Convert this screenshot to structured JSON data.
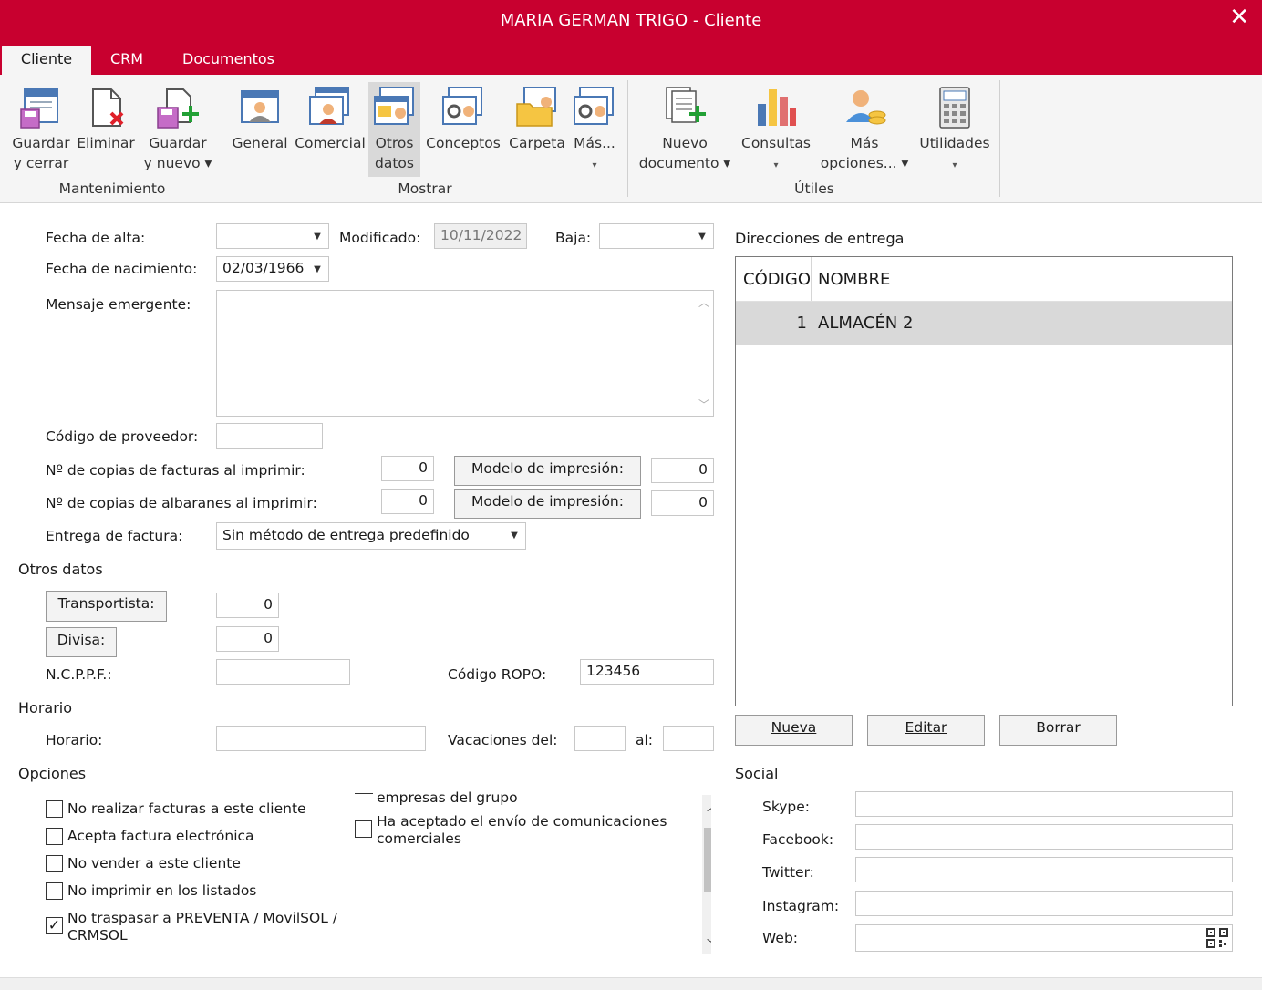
{
  "window": {
    "title": "MARIA GERMAN TRIGO - Cliente",
    "close_glyph": "✕"
  },
  "tabs": [
    {
      "label": "Cliente",
      "active": true
    },
    {
      "label": "CRM",
      "active": false
    },
    {
      "label": "Documentos",
      "active": false
    }
  ],
  "ribbon": {
    "buttons": [
      {
        "line1": "Guardar",
        "line2": "y cerrar",
        "icon": "save-close-icon"
      },
      {
        "line1": "Eliminar",
        "line2": "",
        "icon": "delete-icon"
      },
      {
        "line1": "Guardar",
        "line2": "y nuevo ▾",
        "icon": "save-new-icon"
      },
      {
        "line1": "General",
        "line2": "",
        "icon": "general-icon"
      },
      {
        "line1": "Comercial",
        "line2": "",
        "icon": "commercial-icon"
      },
      {
        "line1": "Otros",
        "line2": "datos",
        "icon": "other-data-icon"
      },
      {
        "line1": "Conceptos",
        "line2": "",
        "icon": "concepts-icon"
      },
      {
        "line1": "Carpeta",
        "line2": "",
        "icon": "folder-icon"
      },
      {
        "line1": "Más...",
        "line2": "▾",
        "icon": "more-icon"
      },
      {
        "line1": "Nuevo",
        "line2": "documento ▾",
        "icon": "new-document-icon"
      },
      {
        "line1": "Consultas",
        "line2": "▾",
        "icon": "queries-icon"
      },
      {
        "line1": "Más",
        "line2": "opciones... ▾",
        "icon": "more-options-icon"
      },
      {
        "line1": "Utilidades",
        "line2": "▾",
        "icon": "utilities-icon"
      }
    ],
    "groups": [
      "Mantenimiento",
      "Mostrar",
      "Útiles"
    ]
  },
  "form": {
    "fecha_alta_label": "Fecha de alta:",
    "fecha_alta_value": "",
    "modificado_label": "Modificado:",
    "modificado_value": "10/11/2022",
    "baja_label": "Baja:",
    "baja_value": "",
    "fecha_nacimiento_label": "Fecha de  nacimiento:",
    "fecha_nacimiento_value": "02/03/1966",
    "mensaje_label": "Mensaje emergente:",
    "mensaje_value": "",
    "codigo_proveedor_label": "Código de proveedor:",
    "codigo_proveedor_value": "",
    "copias_facturas_label": "Nº de copias de facturas al imprimir:",
    "copias_facturas_value": "0",
    "modelo_facturas_label": "Modelo de impresión:",
    "modelo_facturas_value": "0",
    "copias_albaranes_label": "Nº de copias de albaranes al imprimir:",
    "copias_albaranes_value": "0",
    "modelo_albaranes_label": "Modelo de impresión:",
    "modelo_albaranes_value": "0",
    "entrega_factura_label": "Entrega de factura:",
    "entrega_factura_value": "Sin método de entrega predefinido"
  },
  "otros_datos": {
    "title": "Otros datos",
    "transportista_label": "Transportista:",
    "transportista_value": "0",
    "divisa_label": "Divisa:",
    "divisa_value": "0",
    "ncppf_label": "N.C.P.P.F.:",
    "ncppf_value": "",
    "ropo_label": "Código ROPO:",
    "ropo_value": "123456"
  },
  "horario": {
    "title": "Horario",
    "horario_label": "Horario:",
    "horario_value": "",
    "vacaciones_label": "Vacaciones del:",
    "vacaciones_from": "",
    "al_label": "al:",
    "vacaciones_to": ""
  },
  "opciones": {
    "title": "Opciones",
    "left": [
      {
        "label": "No realizar facturas a este cliente",
        "checked": false
      },
      {
        "label": "Acepta factura electrónica",
        "checked": false
      },
      {
        "label": "No vender a este cliente",
        "checked": false
      },
      {
        "label": "No imprimir en los listados",
        "checked": false
      },
      {
        "label": "No traspasar a PREVENTA / MovilSOL /",
        "label2": "CRMSOL",
        "checked": true
      }
    ],
    "right_partial": "empresas del grupo",
    "right": [
      {
        "label": "Ha aceptado el envío de comunicaciones",
        "label2": "comerciales",
        "checked": false
      }
    ]
  },
  "direcciones": {
    "title": "Direcciones de entrega",
    "columns": [
      "CÓDIGO",
      "NOMBRE"
    ],
    "rows": [
      {
        "codigo": "1",
        "nombre": "ALMACÉN 2"
      }
    ],
    "buttons": {
      "nueva": "Nueva",
      "editar": "Editar",
      "borrar": "Borrar"
    }
  },
  "social": {
    "title": "Social",
    "skype_label": "Skype:",
    "facebook_label": "Facebook:",
    "twitter_label": "Twitter:",
    "instagram_label": "Instagram:",
    "web_label": "Web:",
    "skype": "",
    "facebook": "",
    "twitter": "",
    "instagram": "",
    "web": ""
  },
  "colors": {
    "accent": "#c8002f",
    "ribbon_bg": "#f5f5f5",
    "selected_row": "#d9d9d9"
  }
}
